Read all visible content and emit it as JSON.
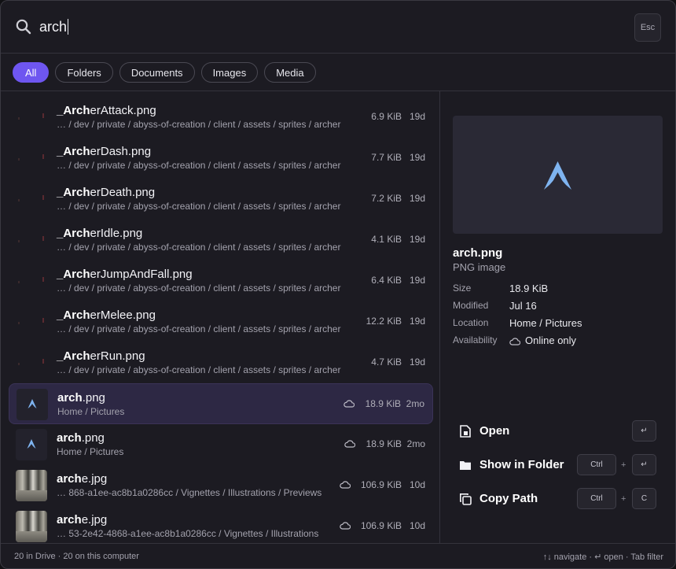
{
  "search": {
    "query": "arch",
    "esc_label": "Esc"
  },
  "filters": [
    "All",
    "Folders",
    "Documents",
    "Images",
    "Media"
  ],
  "active_filter": "All",
  "results": [
    {
      "prefix": "_",
      "match": "Arch",
      "rest": "erAttack.png",
      "path": "…  / dev / private / abyss-of-creation / client / assets / sprites / archer",
      "size": "6.9 KiB",
      "age": "19d",
      "thumb": "sprite"
    },
    {
      "prefix": "_",
      "match": "Arch",
      "rest": "erDash.png",
      "path": "…  / dev / private / abyss-of-creation / client / assets / sprites / archer",
      "size": "7.7 KiB",
      "age": "19d",
      "thumb": "sprite"
    },
    {
      "prefix": "_",
      "match": "Arch",
      "rest": "erDeath.png",
      "path": "…  / dev / private / abyss-of-creation / client / assets / sprites / archer",
      "size": "7.2 KiB",
      "age": "19d",
      "thumb": "sprite"
    },
    {
      "prefix": "_",
      "match": "Arch",
      "rest": "erIdle.png",
      "path": "…  / dev / private / abyss-of-creation / client / assets / sprites / archer",
      "size": "4.1 KiB",
      "age": "19d",
      "thumb": "sprite"
    },
    {
      "prefix": "_",
      "match": "Arch",
      "rest": "erJumpAndFall.png",
      "path": "…  / dev / private / abyss-of-creation / client / assets / sprites / archer",
      "size": "6.4 KiB",
      "age": "19d",
      "thumb": "sprite"
    },
    {
      "prefix": "_",
      "match": "Arch",
      "rest": "erMelee.png",
      "path": "… / dev / private / abyss-of-creation / client / assets / sprites / archer",
      "size": "12.2 KiB",
      "age": "19d",
      "thumb": "sprite"
    },
    {
      "prefix": "_",
      "match": "Arch",
      "rest": "erRun.png",
      "path": "…  / dev / private / abyss-of-creation / client / assets / sprites / archer",
      "size": "4.7 KiB",
      "age": "19d",
      "thumb": "sprite"
    },
    {
      "prefix": "",
      "match": "arch",
      "rest": ".png",
      "path": "Home / Pictures",
      "size": "18.9 KiB",
      "age": "2mo",
      "thumb": "arch",
      "cloud": true,
      "selected": true
    },
    {
      "prefix": "",
      "match": "arch",
      "rest": ".png",
      "path": "Home / Pictures",
      "size": "18.9 KiB",
      "age": "2mo",
      "thumb": "arch",
      "cloud": true
    },
    {
      "prefix": "",
      "match": "arch",
      "rest": "e.jpg",
      "path": "… 868-a1ee-ac8b1a0286cc / Vignettes / Illustrations / Previews",
      "size": "106.9 KiB",
      "age": "10d",
      "thumb": "photo",
      "cloud": true
    },
    {
      "prefix": "",
      "match": "arch",
      "rest": "e.jpg",
      "path": "… 53-2e42-4868-a1ee-ac8b1a0286cc / Vignettes / Illustrations",
      "size": "106.9 KiB",
      "age": "10d",
      "thumb": "photo",
      "cloud": true
    }
  ],
  "preview": {
    "name": "arch.png",
    "type": "PNG image",
    "meta": [
      {
        "key": "Size",
        "value": "18.9 KiB"
      },
      {
        "key": "Modified",
        "value": "Jul 16"
      },
      {
        "key": "Location",
        "value": "Home / Pictures"
      },
      {
        "key": "Availability",
        "value": "Online only"
      }
    ]
  },
  "actions": [
    {
      "label": "Open",
      "keys": [
        "↵"
      ]
    },
    {
      "label": "Show in Folder",
      "keys": [
        "Ctrl",
        "↵"
      ]
    },
    {
      "label": "Copy Path",
      "keys": [
        "Ctrl",
        "C"
      ]
    }
  ],
  "plus": "+",
  "footer": {
    "left": "20 in Drive · 20 on this computer",
    "right": "↑↓ navigate · ↵ open · Tab filter"
  },
  "colors": {
    "accent": "#6e56f0",
    "selected_row": "#2d2844",
    "arch_logo": "#7fb4f0"
  }
}
